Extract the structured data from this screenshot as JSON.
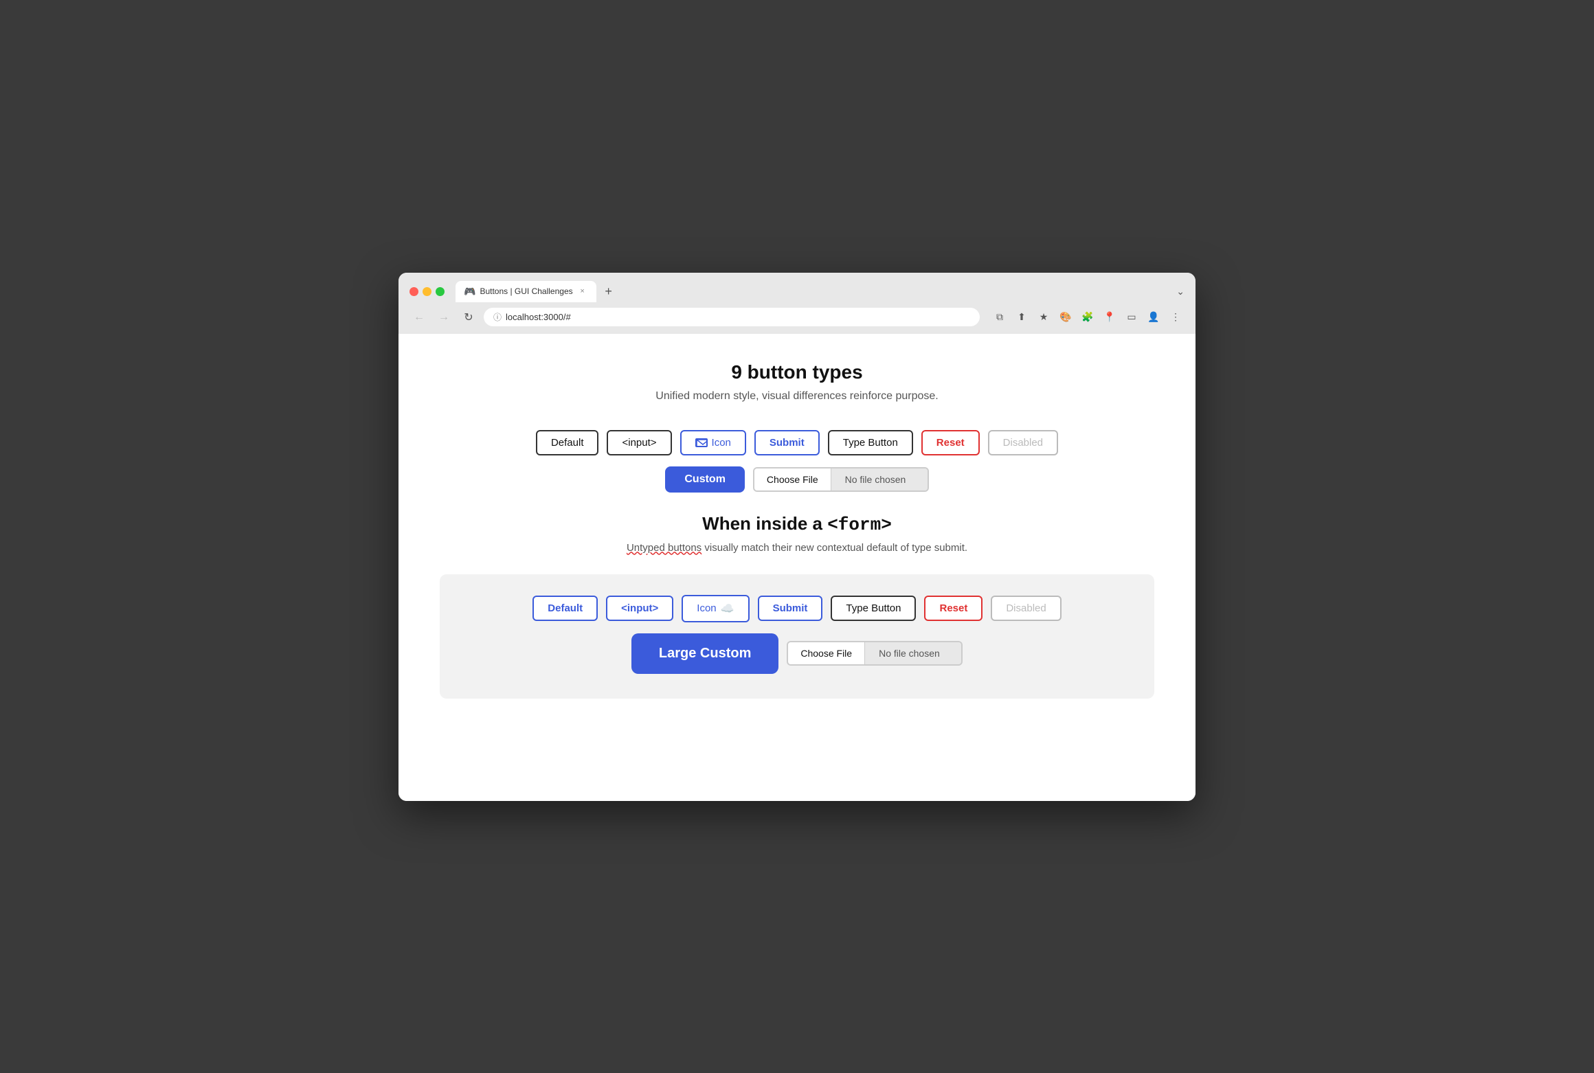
{
  "browser": {
    "controls": {
      "close_label": "×",
      "minimize_label": "−",
      "maximize_label": "+"
    },
    "tab": {
      "favicon": "🎮",
      "title": "Buttons | GUI Challenges",
      "close": "×"
    },
    "new_tab_label": "+",
    "chevron_label": "⌄",
    "nav": {
      "back": "←",
      "forward": "→",
      "reload": "↻"
    },
    "address": {
      "lock_icon": "ⓘ",
      "url": "localhost:3000/#"
    },
    "toolbar": {
      "external_link": "⧉",
      "share": "⬆",
      "bookmark": "★",
      "extension1": "🎨",
      "extension2": "🧩",
      "extension3": "📍",
      "sidebar": "▭",
      "profile": "👤",
      "menu": "⋮"
    }
  },
  "page": {
    "title": "9 button types",
    "subtitle": "Unified modern style, visual differences reinforce purpose.",
    "row1": {
      "default_btn": "Default",
      "input_btn": "<input>",
      "icon_btn": "Icon",
      "submit_btn": "Submit",
      "type_button_btn": "Type Button",
      "reset_btn": "Reset",
      "disabled_btn": "Disabled"
    },
    "row2": {
      "custom_btn": "Custom",
      "choose_file_btn": "Choose File",
      "no_file_text": "No file chosen"
    },
    "form_section": {
      "title": "When inside a ",
      "title_code": "<form>",
      "subtitle_plain": " visually match their new contextual default of type submit.",
      "subtitle_underlined": "Untyped buttons",
      "subtitle_rest": " visually match their new contextual default of type submit.",
      "row1": {
        "default_btn": "Default",
        "input_btn": "<input>",
        "icon_btn": "Icon",
        "submit_btn": "Submit",
        "type_button_btn": "Type Button",
        "reset_btn": "Reset",
        "disabled_btn": "Disabled"
      },
      "row2": {
        "large_custom_btn": "Large Custom",
        "choose_file_btn": "Choose File",
        "no_file_text": "No file chosen"
      }
    }
  }
}
